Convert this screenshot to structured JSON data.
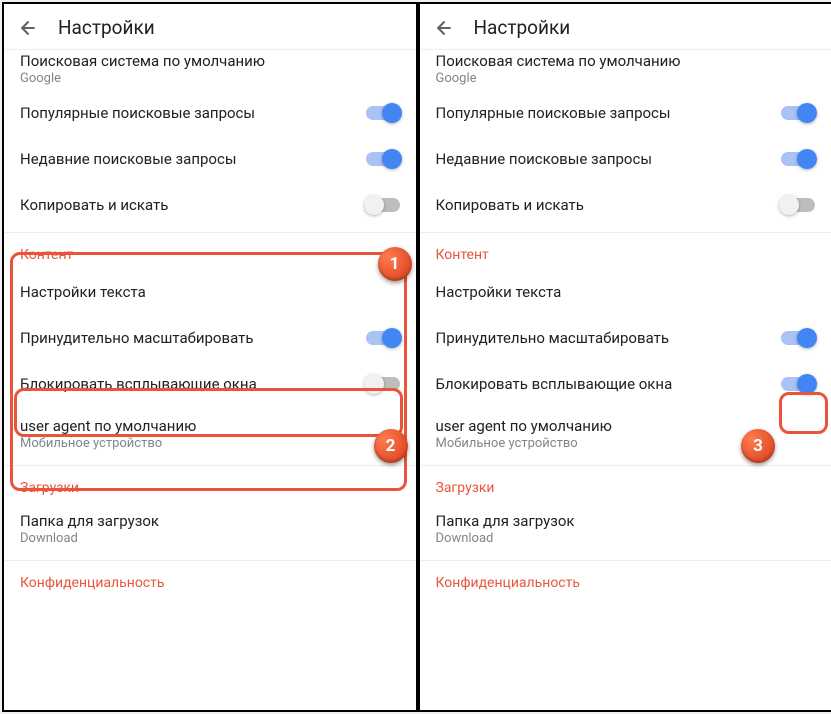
{
  "header": {
    "title": "Настройки"
  },
  "search_engine": {
    "label": "Поисковая система по умолчанию",
    "value": "Google"
  },
  "rows": {
    "popular": "Популярные поисковые запросы",
    "recent": "Недавние поисковые запросы",
    "copy_search": "Копировать и искать"
  },
  "sections": {
    "content": "Контент",
    "downloads": "Загрузки",
    "privacy": "Конфиденциальность"
  },
  "content_rows": {
    "text_settings": "Настройки текста",
    "force_zoom": "Принудительно масштабировать",
    "block_popups": "Блокировать всплывающие окна",
    "user_agent": {
      "label": "user agent по умолчанию",
      "value": "Мобильное устройство"
    }
  },
  "download_rows": {
    "folder": {
      "label": "Папка для загрузок",
      "value": "Download"
    }
  },
  "badges": {
    "b1": "1",
    "b2": "2",
    "b3": "3"
  }
}
